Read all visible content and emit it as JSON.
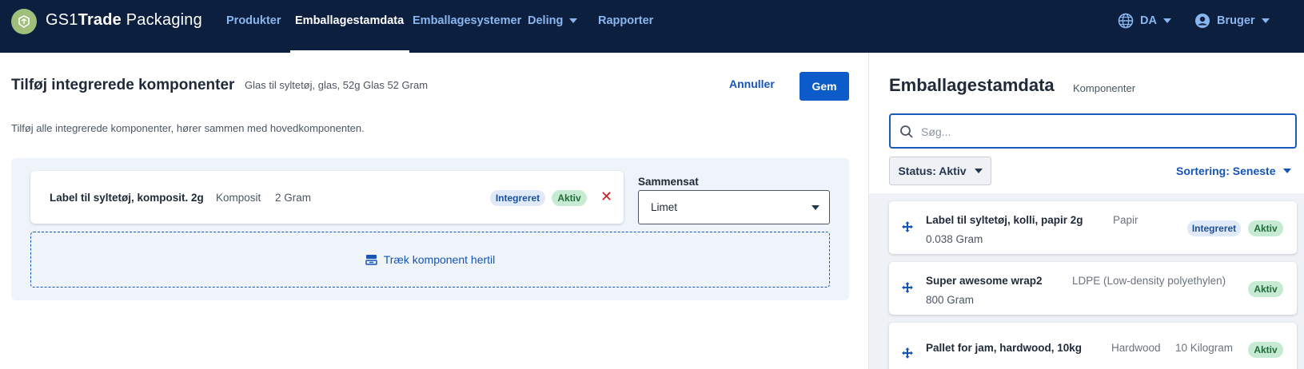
{
  "header": {
    "logo_prefix": "GS1",
    "logo_bold": "Trade",
    "logo_suffix": " Packaging",
    "nav": [
      {
        "label": "Produkter",
        "active": false
      },
      {
        "label": "Emballagestamdata",
        "active": true
      },
      {
        "label": "Emballagesystemer",
        "active": false
      },
      {
        "label": "Deling",
        "active": false,
        "dropdown": true
      },
      {
        "label": "Rapporter",
        "active": false
      }
    ],
    "language": "DA",
    "user": "Bruger",
    "icons": {
      "language": "globe-icon",
      "user": "user-circle-icon"
    }
  },
  "editor": {
    "title": "Tilføj integrerede komponenter",
    "subtitle": "Glas til syltetøj, glas, 52g Glas 52 Gram",
    "cancel_label": "Annuller",
    "save_label": "Gem",
    "description": "Tilføj alle integrerede komponenter, hører sammen med hovedkomponenten.",
    "component": {
      "name": "Label til syltetøj, komposit. 2g",
      "material": "Komposit",
      "weight": "2 Gram",
      "badge_integrated": "Integreret",
      "badge_status": "Aktiv"
    },
    "sammensat_label": "Sammensat",
    "sammensat_value": "Limet",
    "dropzone_label": "Træk komponent hertil"
  },
  "sidebar": {
    "title": "Emballagestamdata",
    "subtitle": "Komponenter",
    "search_placeholder": "Søg...",
    "status_filter": "Status: Aktiv",
    "sort_label": "Sortering: Seneste",
    "items": [
      {
        "name": "Label til syltetøj, kolli, papir 2g",
        "material": "Papir",
        "weight": "0.038 Gram",
        "badge_integrated": "Integreret",
        "badge_status": "Aktiv"
      },
      {
        "name": "Super awesome wrap2",
        "material": "LDPE (Low-density polyethylen)",
        "weight": "800 Gram",
        "badge_status": "Aktiv"
      },
      {
        "name": "Pallet for jam, hardwood, 10kg",
        "material": "Hardwood",
        "weight": "10 Kilogram",
        "badge_status": "Aktiv"
      }
    ]
  },
  "colors": {
    "header_bg": "#0c1f3f",
    "nav_link": "#8ab6ef",
    "primary": "#0b5bc9",
    "badge_integrated_bg": "#dfe9f7",
    "badge_active_bg": "#c6ebd2",
    "danger": "#d11a1a"
  }
}
